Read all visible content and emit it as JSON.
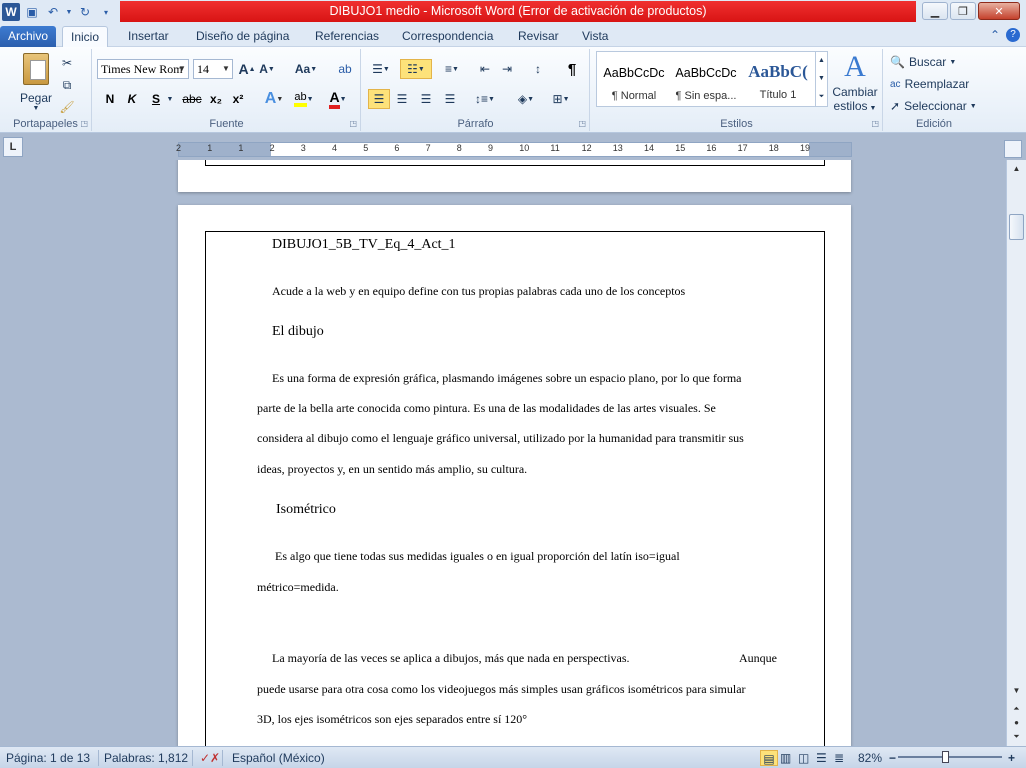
{
  "window": {
    "title": "DIBUJO1 medio  -  Microsoft Word (Error de activación de productos)"
  },
  "tabs": [
    {
      "label": "Archivo"
    },
    {
      "label": "Inicio"
    },
    {
      "label": "Insertar"
    },
    {
      "label": "Diseño de página"
    },
    {
      "label": "Referencias"
    },
    {
      "label": "Correspondencia"
    },
    {
      "label": "Revisar"
    },
    {
      "label": "Vista"
    }
  ],
  "ribbon": {
    "clipboard": {
      "paste_label": "Pegar",
      "group_label": "Portapapeles"
    },
    "font": {
      "font_name": "Times New Rom",
      "font_size": "14",
      "group_label": "Fuente",
      "bold": "N",
      "italic": "K",
      "underline": "S",
      "strike": "abc",
      "subscript": "x₂",
      "superscript": "x²",
      "grow": "A",
      "shrink": "A",
      "case": "Aa",
      "effects": "A",
      "font_color": "A"
    },
    "paragraph": {
      "group_label": "Párrafo",
      "pilcrow": "¶"
    },
    "styles": {
      "group_label": "Estilos",
      "items": [
        {
          "sample": "AaBbCcDc",
          "name": "¶ Normal"
        },
        {
          "sample": "AaBbCcDc",
          "name": "¶ Sin espa..."
        },
        {
          "sample": "AaBbC(",
          "name": "Título 1"
        }
      ],
      "change_label_1": "Cambiar",
      "change_label_2": "estilos"
    },
    "editing": {
      "group_label": "Edición",
      "find": "Buscar",
      "replace": "Reemplazar",
      "select": "Seleccionar"
    }
  },
  "ruler": {
    "numbers": [
      "2",
      "1",
      "1",
      "2",
      "3",
      "4",
      "5",
      "6",
      "7",
      "8",
      "9",
      "10",
      "11",
      "12",
      "13",
      "14",
      "15",
      "16",
      "17",
      "18",
      "19"
    ]
  },
  "document": {
    "header": "DIBUJO1_5B_TV_Eq_4_Act_1",
    "intro": "Acude a la web y en equipo define con tus propias palabras cada uno de los conceptos",
    "heading1": "El dibujo",
    "p1_l1": "Es una forma de expresión gráfica, plasmando imágenes sobre un espacio plano, por lo  que forma",
    "p1_l2": "parte de la bella arte conocida como pintura. Es una de las modalidades de las artes visuales. Se",
    "p1_l3": "considera al dibujo como el lenguaje gráfico universal, utilizado por la humanidad para transmitir sus",
    "p1_l4": "ideas, proyectos y, en un sentido más amplio, su cultura.",
    "heading2": "Isométrico",
    "p2_l1": "Es algo que tiene todas sus medidas iguales o en igual proporción del latín iso=igual",
    "p2_l2": "métrico=medida.",
    "p3_l1a": "La mayoría de las veces se aplica a dibujos, más que nada en perspectivas.",
    "p3_l1b": "Aunque",
    "p3_l2": "puede usarse para otra cosa como los videojuegos más simples usan gráficos isométricos para simular",
    "p3_l3": "3D, los ejes isométricos son ejes separados entre sí 120°"
  },
  "status": {
    "page": "Página: 1 de 13",
    "words": "Palabras: 1,812",
    "language": "Español (México)",
    "zoom": "82%",
    "minus": "−",
    "plus": "+"
  }
}
